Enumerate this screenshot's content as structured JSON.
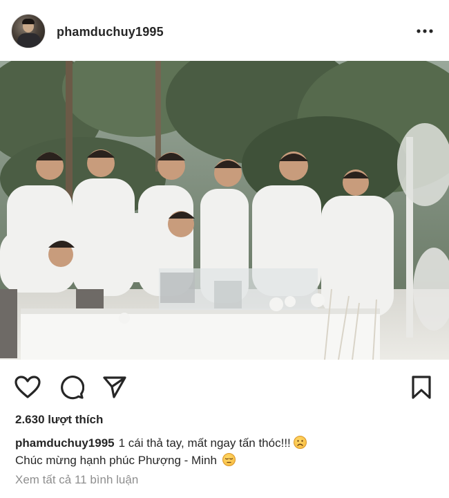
{
  "post": {
    "username": "phamduchuy1995",
    "avatar_icon": "user-avatar",
    "more_icon": "more-options-icon",
    "photo_description_alt": "Photo"
  },
  "actions": {
    "like_icon": "heart-icon",
    "comment_icon": "comment-icon",
    "share_icon": "send-icon",
    "save_icon": "bookmark-icon"
  },
  "likes_text": "2.630 lượt thích",
  "caption": {
    "username": "phamduchuy1995",
    "line1": "1 cái thả tay, mất ngay tấn thóc!!!",
    "line1_emoji": "frowning-face-emoji",
    "line2": "Chúc mừng hạnh phúc Phượng - Minh",
    "line2_emoji": "relieved-face-emoji"
  },
  "comments_link": "Xem tất cả 11 bình luận",
  "colors": {
    "text": "#262626",
    "muted": "#8e8e8e",
    "background": "#ffffff"
  }
}
